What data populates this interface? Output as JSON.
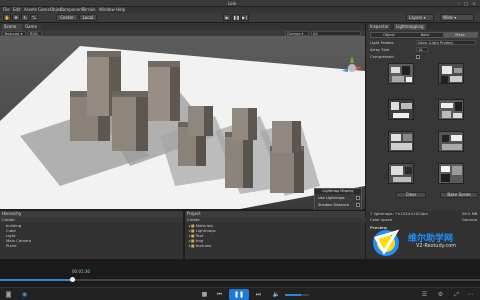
{
  "window": {
    "title": "Lolo"
  },
  "menu": [
    "File",
    "Edit",
    "Assets",
    "GameObject",
    "Component",
    "Terrain",
    "Window",
    "Help"
  ],
  "toolbar": {
    "center": "Center",
    "local": "Local",
    "layers": "Layers",
    "layout": "Wide"
  },
  "scene": {
    "tabs": [
      "Scene",
      "Game"
    ],
    "draw_mode": "RGB",
    "gizmos": "Gizmos",
    "search": "All"
  },
  "lightmap_display": {
    "title": "Lightmap Display",
    "options": [
      "Use Lightmaps",
      "Shadow Distance",
      "Show Resolution",
      "Show Probes",
      "Show Cells"
    ]
  },
  "inspector": {
    "tabs": [
      "Inspector",
      "Lightmapping"
    ],
    "subtabs": [
      "Object",
      "Bake",
      "Maps"
    ],
    "rows": [
      {
        "label": "Light Probes",
        "value": "None (Light Probes)"
      },
      {
        "label": "Array Size",
        "value": "16"
      },
      {
        "label": "Compressed",
        "value": ""
      }
    ],
    "footer_buttons": [
      "Clear",
      "Bake Scene"
    ],
    "stats": [
      "7 lightmaps: 7×1024×1024px",
      "Color space",
      "Gamma"
    ],
    "stats_values": [
      "28.0 MB"
    ],
    "preview_label": "Preview"
  },
  "hierarchy": {
    "title": "Hierarchy",
    "create": "Create",
    "items": [
      "building",
      "Cube",
      "Light",
      "Main Camera",
      "Plane"
    ]
  },
  "project": {
    "title": "Project",
    "create": "Create",
    "items": [
      "Materials",
      "Lightmaps",
      "Text",
      "tmp",
      "textures"
    ]
  },
  "player": {
    "time": "00:01:36",
    "watermark_cn": "维尔助学网",
    "watermark_url": "V2-Restudy.com"
  },
  "colors": {
    "accent": "#1e90ff",
    "panel": "#373737"
  }
}
